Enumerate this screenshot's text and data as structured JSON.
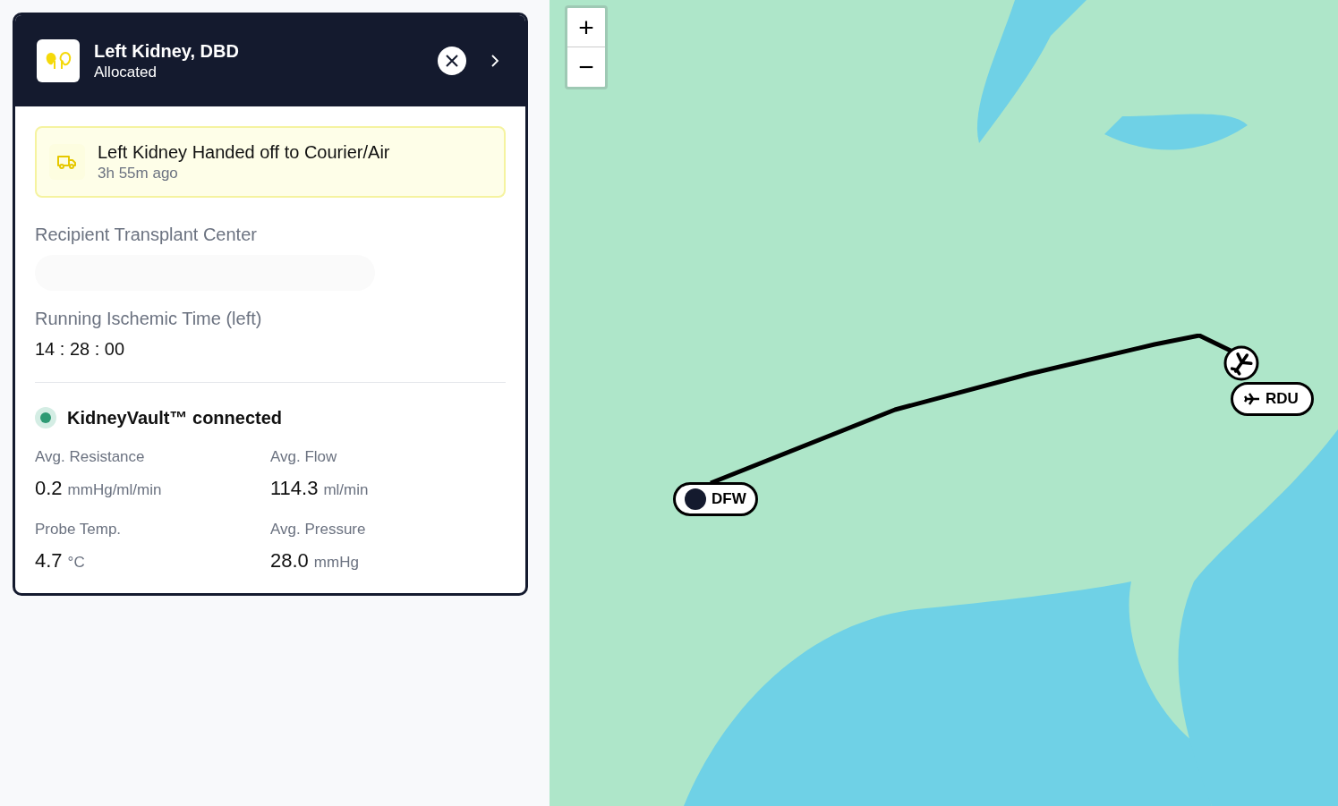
{
  "organ": {
    "title": "Left Kidney, DBD",
    "status": "Allocated"
  },
  "event": {
    "title": "Left Kidney Handed off to Courier/Air",
    "time": "3h 55m ago"
  },
  "recipient": {
    "label": "Recipient Transplant Center"
  },
  "ischemic": {
    "label": "Running Ischemic Time (left)",
    "value": "14 : 28 : 00"
  },
  "device": {
    "name": "KidneyVault™ connected",
    "connected": true
  },
  "metrics": [
    {
      "label": "Avg. Resistance",
      "value": "0.2",
      "unit": "mmHg/ml/min"
    },
    {
      "label": "Avg. Flow",
      "value": "114.3",
      "unit": "ml/min"
    },
    {
      "label": "Probe Temp.",
      "value": "4.7",
      "unit": "°C"
    },
    {
      "label": "Avg. Pressure",
      "value": "28.0",
      "unit": "mmHg"
    }
  ],
  "map": {
    "zoom_in": "+",
    "zoom_out": "−",
    "origin": {
      "code": "DFW"
    },
    "destination": {
      "code": "RDU"
    }
  }
}
